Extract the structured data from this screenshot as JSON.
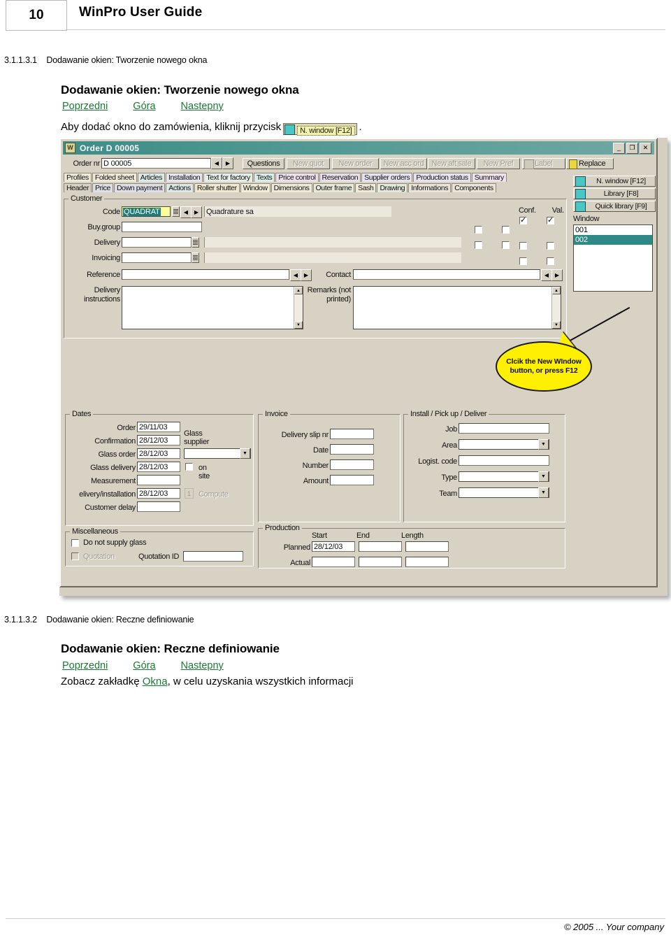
{
  "page": {
    "number": "10",
    "doc_title": "WinPro User Guide",
    "footer": "© 2005 ...  Your company"
  },
  "section1": {
    "number": "3.1.1.3.1",
    "number_title": "Dodawanie okien: Tworzenie nowego okna",
    "heading": "Dodawanie okien: Tworzenie nowego okna",
    "nav": [
      "Poprzedni",
      "Góra",
      "Nastepny"
    ],
    "paragraph_before": "Aby dodać okno do zamówienia, kliknij przycisk",
    "paragraph_after": ".",
    "inline_button": {
      "icon": "new-window-icon",
      "label": "N. window [F12]"
    }
  },
  "section2": {
    "number": "3.1.1.3.2",
    "number_title": "Dodawanie okien: Reczne definiowanie",
    "heading": "Dodawanie okien: Reczne definiowanie",
    "nav": [
      "Poprzedni",
      "Góra",
      "Nastepny"
    ],
    "paragraph_pre": "Zobacz zakładkę ",
    "paragraph_link": "Okna",
    "paragraph_post": ", w celu uzyskania wszystkich informacji"
  },
  "screenshot": {
    "window": {
      "title": "Order D 00005",
      "icon_letter": "W",
      "controls": [
        "_",
        "❐",
        "✕"
      ]
    },
    "order_row": {
      "label": "Order nr",
      "value": "D 00005",
      "prev_arrow": "◀",
      "next_arrow": "▶"
    },
    "toolbar": [
      {
        "label": "Questions",
        "enabled": true
      },
      {
        "label": "New quot",
        "enabled": false
      },
      {
        "label": "New order",
        "enabled": false
      },
      {
        "label": "New acc ord",
        "enabled": false
      },
      {
        "label": "New aft sale",
        "enabled": false
      },
      {
        "label": "New Pref",
        "enabled": false
      },
      {
        "label": "Label",
        "enabled": false
      },
      {
        "label": "Replace",
        "enabled": true
      }
    ],
    "tabs_top": [
      {
        "label": "Profiles",
        "color": "#efe9d8"
      },
      {
        "label": "Folded sheet",
        "color": "#efe9d8"
      },
      {
        "label": "Articles",
        "color": "#dde9e4"
      },
      {
        "label": "Installation",
        "color": "#e6e6ee"
      },
      {
        "label": "Text for factory",
        "color": "#e4eee6"
      },
      {
        "label": "Texts",
        "color": "#dcece9"
      },
      {
        "label": "Price control",
        "color": "#eddfe9"
      },
      {
        "label": "Reservation",
        "color": "#e8dfe8"
      },
      {
        "label": "Supplier orders",
        "color": "#e6e2ee"
      },
      {
        "label": "Production status",
        "color": "#e6e2ee"
      },
      {
        "label": "Summary",
        "color": "#efe2ea"
      }
    ],
    "tabs_bottom": [
      {
        "label": "Header",
        "color": "#d7d2c4",
        "selected": true
      },
      {
        "label": "Price",
        "color": "#dedee8"
      },
      {
        "label": "Down payment",
        "color": "#dedee8"
      },
      {
        "label": "Actions",
        "color": "#dee6e6"
      },
      {
        "label": "Roller shutter",
        "color": "#efe9d2"
      },
      {
        "label": "Window",
        "color": "#efecd8"
      },
      {
        "label": "Dimensions",
        "color": "#efe9d8"
      },
      {
        "label": "Outer frame",
        "color": "#e6e9d8"
      },
      {
        "label": "Sash",
        "color": "#efe9d8"
      },
      {
        "label": "Drawing",
        "color": "#e4e9dd"
      },
      {
        "label": "Informations",
        "color": "#e9e4d8"
      },
      {
        "label": "Components",
        "color": "#e9e4d8"
      }
    ],
    "customer_group": {
      "title": "Customer",
      "code_label": "Code",
      "code_value": "QUADRAT",
      "code_name": "Quadrature sa",
      "buy_group_label": "Buy.group",
      "buy_group_value": "",
      "delivery_label": "Delivery",
      "delivery_value": "",
      "invoicing_label": "Invoicing",
      "invoicing_value": "",
      "reference_label": "Reference",
      "reference_value": "",
      "contact_label": "Contact",
      "contact_value": "",
      "delivery_instructions_label": "Delivery instructions",
      "delivery_instructions_value": "",
      "remarks_label": "Remarks (not printed)",
      "remarks_value": ""
    },
    "check_columns": {
      "conf": "Conf.",
      "val": "Val.",
      "rows": [
        {
          "conf": true,
          "val": true
        },
        {
          "conf": false,
          "val": false
        },
        {
          "conf": false,
          "val": false
        }
      ]
    },
    "callout": {
      "text": "Clcik the New WIndow button, or press F12"
    },
    "right_rail": {
      "buttons": [
        {
          "label": "N. window [F12]",
          "icon": "new-window-icon"
        },
        {
          "label": "Library [F8]",
          "icon": "library-icon"
        },
        {
          "label": "Quick library [F9]",
          "icon": "quick-library-icon"
        }
      ],
      "list_title": "Window",
      "list_items": [
        {
          "label": "001",
          "selected": false
        },
        {
          "label": "002",
          "selected": true
        }
      ]
    },
    "dates_group": {
      "title": "Dates",
      "rows": [
        {
          "label": "Order",
          "value": "29/11/03"
        },
        {
          "label": "Confirmation",
          "value": "28/12/03"
        },
        {
          "label": "Glass order",
          "value": "28/12/03"
        },
        {
          "label": "Glass delivery",
          "value": "28/12/03"
        },
        {
          "label": "Measurement",
          "value": ""
        },
        {
          "label": "elivery/installation",
          "value": "28/12/03"
        },
        {
          "label": "Customer delay",
          "value": ""
        }
      ],
      "glass_supplier_label": "Glass supplier",
      "glass_supplier_value": "",
      "on_site_label": "on site",
      "on_site_checked": false,
      "compute_label": "Compute",
      "compute_badge": "1"
    },
    "misc_group": {
      "title": "Miscellaneous",
      "do_not_supply_label": "Do not supply glass",
      "do_not_supply_checked": false,
      "quotation_label": "Quotation",
      "quotation_checked": false,
      "quotation_id_label": "Quotation ID",
      "quotation_id_value": ""
    },
    "invoice_group": {
      "title": "Invoice",
      "rows": [
        {
          "label": "Delivery slip nr",
          "value": ""
        },
        {
          "label": "Date",
          "value": ""
        },
        {
          "label": "Number",
          "value": ""
        },
        {
          "label": "Amount",
          "value": ""
        }
      ]
    },
    "install_group": {
      "title": "Install / Pick up / Deliver",
      "rows": [
        {
          "label": "Job",
          "value": "",
          "combo": false
        },
        {
          "label": "Area",
          "value": "",
          "combo": true
        },
        {
          "label": "Logist. code",
          "value": "",
          "combo": false
        },
        {
          "label": "Type",
          "value": "",
          "combo": true
        },
        {
          "label": "Team",
          "value": "",
          "combo": true
        }
      ]
    },
    "production_group": {
      "title": "Production",
      "headers": [
        "Start",
        "End",
        "Length"
      ],
      "rows": [
        {
          "label": "Planned",
          "values": [
            "28/12/03",
            "",
            ""
          ]
        },
        {
          "label": "Actual",
          "values": [
            "",
            "",
            ""
          ]
        }
      ]
    }
  }
}
